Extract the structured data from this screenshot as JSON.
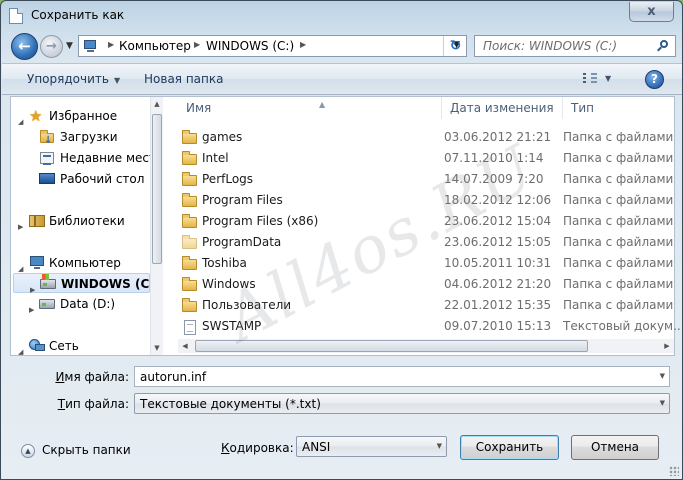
{
  "window": {
    "title": "Сохранить как",
    "close_glyph": "x"
  },
  "address": {
    "breadcrumbs": [
      "Компьютер",
      "WINDOWS (C:)"
    ],
    "search_placeholder": "Поиск: WINDOWS (C:)"
  },
  "toolbar": {
    "organize": "Упорядочить",
    "new_folder": "Новая папка",
    "help": "?"
  },
  "nav": {
    "favorites": "Избранное",
    "downloads": "Загрузки",
    "recent": "Недавние места",
    "desktop": "Рабочий стол",
    "libraries": "Библиотеки",
    "computer": "Компьютер",
    "drive_c": "WINDOWS (C:)",
    "drive_d": "Data (D:)",
    "network": "Сеть"
  },
  "columns": {
    "name": "Имя",
    "date": "Дата изменения",
    "type": "Тип"
  },
  "files": [
    {
      "name": "games",
      "date": "03.06.2012 21:21",
      "type": "Папка с файлами",
      "icon": "folder-icon"
    },
    {
      "name": "Intel",
      "date": "07.11.2010 1:14",
      "type": "Папка с файлами",
      "icon": "folder-icon"
    },
    {
      "name": "PerfLogs",
      "date": "14.07.2009 7:20",
      "type": "Папка с файлами",
      "icon": "folder-icon"
    },
    {
      "name": "Program Files",
      "date": "18.02.2012 12:06",
      "type": "Папка с файлами",
      "icon": "folder-icon"
    },
    {
      "name": "Program Files (x86)",
      "date": "23.06.2012 15:04",
      "type": "Папка с файлами",
      "icon": "folder-icon"
    },
    {
      "name": "ProgramData",
      "date": "23.06.2012 15:05",
      "type": "Папка с файлами",
      "icon": "folder-icon"
    },
    {
      "name": "Toshiba",
      "date": "10.05.2011 10:31",
      "type": "Папка с файлами",
      "icon": "folder-icon"
    },
    {
      "name": "Windows",
      "date": "04.06.2012 21:20",
      "type": "Папка с файлами",
      "icon": "folder-icon"
    },
    {
      "name": "Пользователи",
      "date": "22.01.2012 15:35",
      "type": "Папка с файлами",
      "icon": "folder-icon"
    },
    {
      "name": "SWSTAMP",
      "date": "09.07.2010 15:13",
      "type": "Текстовый докум...",
      "icon": "text-file-icon"
    }
  ],
  "form": {
    "filename_label_u": "И",
    "filename_label_rest": "мя файла:",
    "filename_value": "autorun.inf",
    "filetype_label_u": "Т",
    "filetype_label_rest": "ип файла:",
    "filetype_value": "Текстовые документы (*.txt)",
    "encoding_label_u": "К",
    "encoding_label_rest": "одировка:",
    "encoding_value": "ANSI"
  },
  "footer": {
    "hide_folders": "Скрыть папки",
    "save": "Сохранить",
    "cancel": "Отмена"
  },
  "watermark": "All4os.RU"
}
